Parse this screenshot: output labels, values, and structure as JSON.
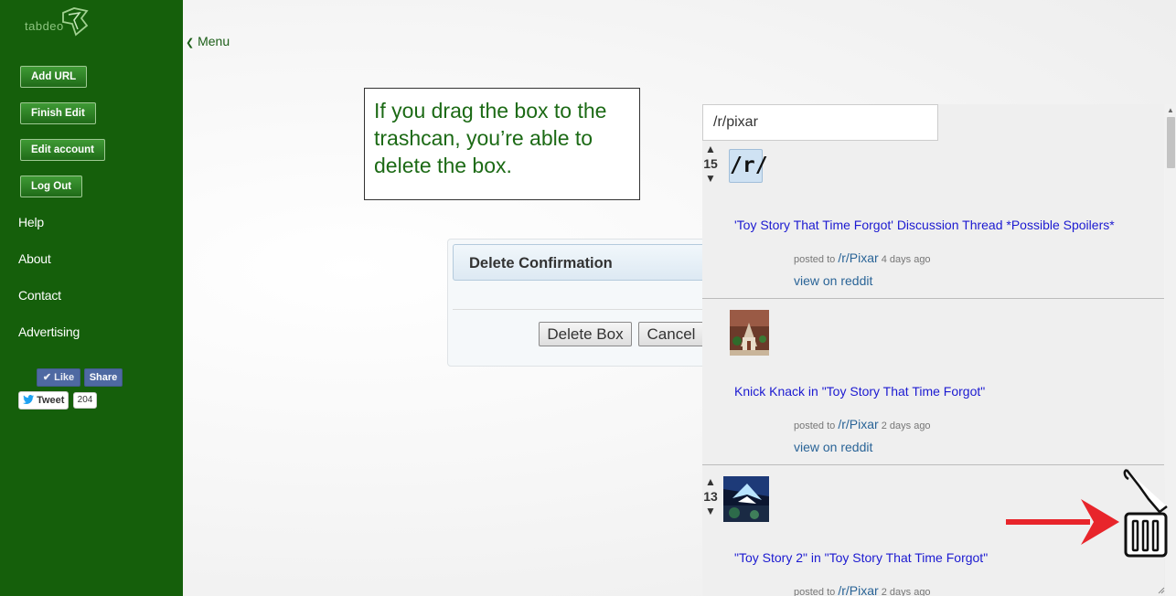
{
  "brand": {
    "logo_text": "tabdeo"
  },
  "sidebar": {
    "buttons": [
      "Add URL",
      "Finish Edit",
      "Edit account",
      "Log Out"
    ],
    "links": [
      "Help",
      "About",
      "Contact",
      "Advertising"
    ],
    "social": {
      "like": "Like",
      "share": "Share",
      "tweet": "Tweet",
      "tweet_count": "204"
    }
  },
  "menu": {
    "label": "Menu",
    "icon": "chevron-left-icon"
  },
  "callout": {
    "text": "If you drag the box to the trashcan, you’re able to delete the box."
  },
  "dialog": {
    "title": "Delete Confirmation",
    "confirm_label": "Delete Box",
    "cancel_label": "Cancel"
  },
  "feed": {
    "search_value": "/r/pixar",
    "posts": [
      {
        "score": "15",
        "thumb_text": "/r/",
        "title": "'Toy Story That Time Forgot' Discussion Thread *Possible Spoilers*",
        "meta_prefix": "posted to",
        "subreddit": "/r/Pixar",
        "age": "4 days ago",
        "view_label": "view on reddit"
      },
      {
        "score": "",
        "thumb_text": "",
        "title": "Knick Knack in \"Toy Story That Time Forgot\"",
        "meta_prefix": "posted to",
        "subreddit": "/r/Pixar",
        "age": "2 days ago",
        "view_label": "view on reddit"
      },
      {
        "score": "13",
        "thumb_text": "",
        "title": "\"Toy Story 2\" in \"Toy Story That Time Forgot\"",
        "meta_prefix": "posted to",
        "subreddit": "/r/Pixar",
        "age": "2 days ago",
        "view_label": ""
      }
    ]
  },
  "colors": {
    "sidebar_bg": "#155f0b",
    "callout_text": "#1c6a15",
    "post_title": "#1c1ad1",
    "annotation_arrow": "#e8252b"
  },
  "icons": {
    "trash": "trash-can-open-icon",
    "arrow": "red-arrow-right-icon"
  }
}
